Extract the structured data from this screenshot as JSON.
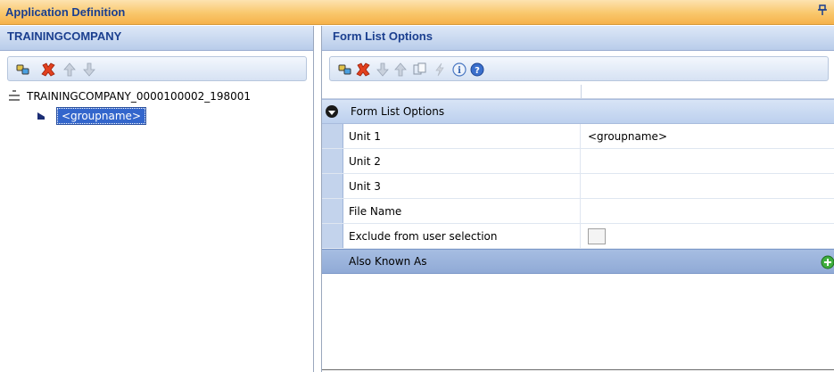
{
  "window": {
    "title": "Application Definition",
    "pin_glyph": "ᵖ"
  },
  "left_panel": {
    "header": "TRAININGCOMPANY",
    "toolbar_icons": [
      "link-icon",
      "delete-icon",
      "move-up-icon",
      "move-down-icon"
    ],
    "tree": {
      "root_label": "TRAININGCOMPANY_0000100002_198001",
      "child_label": "<groupname>"
    }
  },
  "right_panel": {
    "header": "Form List Options",
    "toolbar_icons": [
      "link-icon",
      "delete-icon",
      "move-down-icon",
      "move-up-icon",
      "copy-icon",
      "lightning-icon",
      "info-icon",
      "help-icon"
    ],
    "grid": {
      "category": "Form List Options",
      "properties": [
        {
          "name": "Unit 1",
          "value": "<groupname>"
        },
        {
          "name": "Unit 2",
          "value": ""
        },
        {
          "name": "Unit 3",
          "value": ""
        },
        {
          "name": "File Name",
          "value": ""
        },
        {
          "name": "Exclude from user selection",
          "value": ""
        }
      ],
      "also_known_as": "Also Known As"
    }
  },
  "colors": {
    "title_gradient": "#f9c76c",
    "header_text": "#1b3f8f",
    "selection": "#3366cc"
  }
}
